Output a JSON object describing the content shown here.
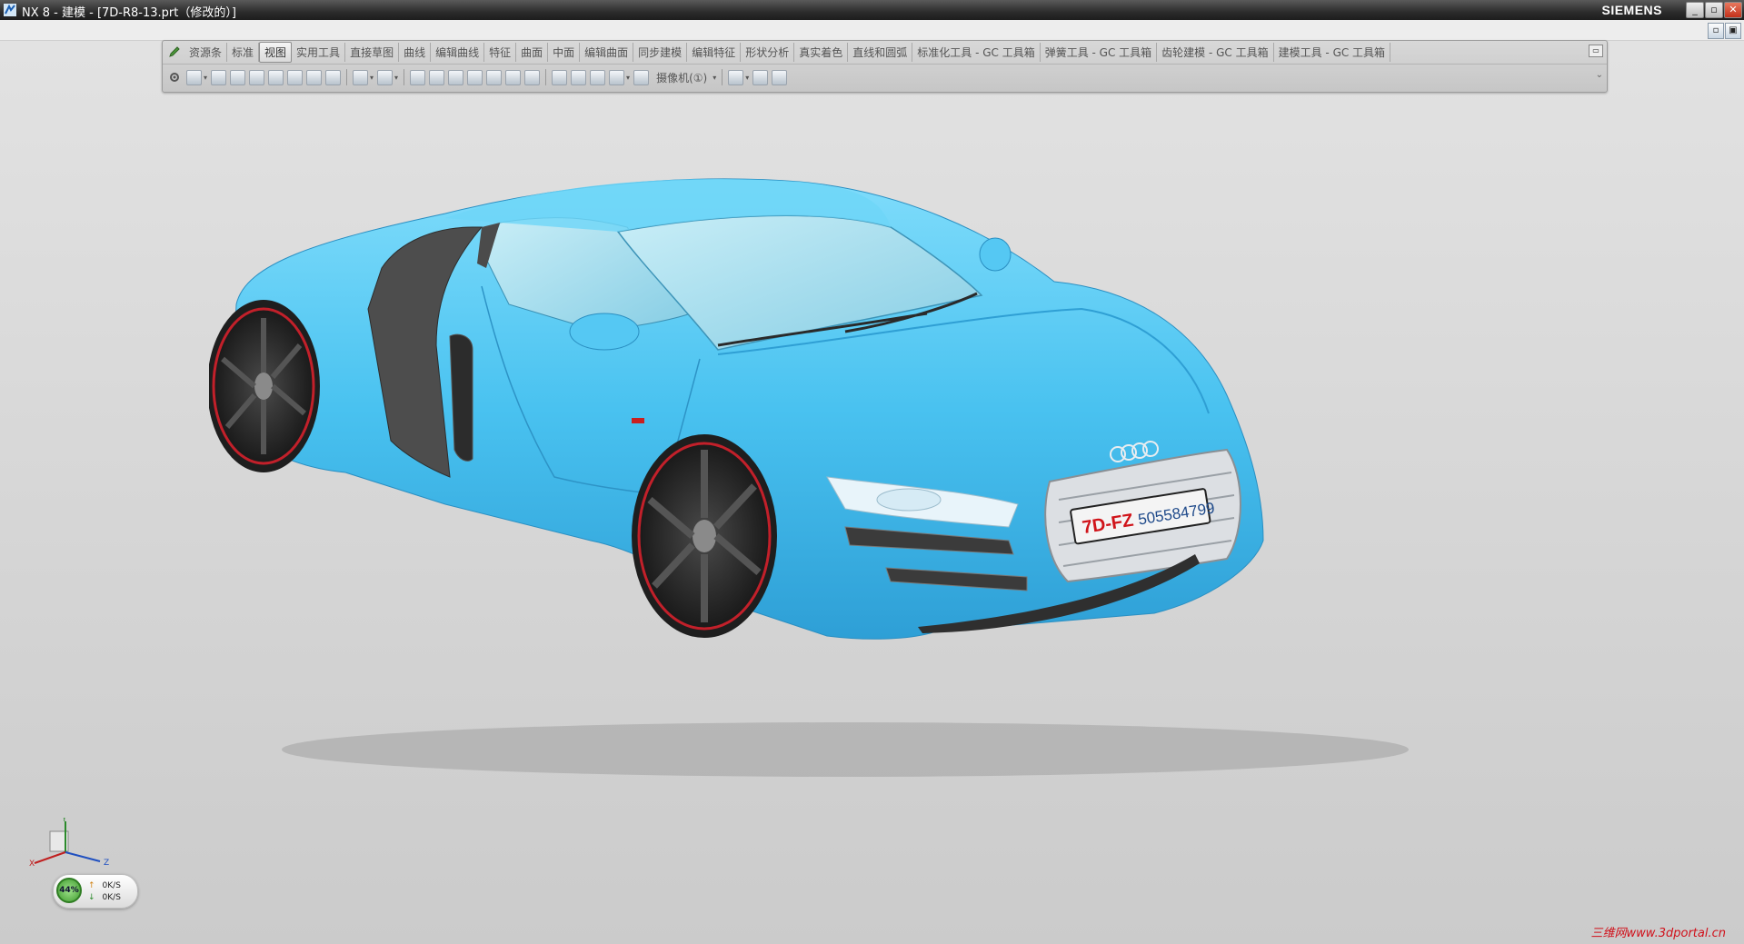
{
  "window": {
    "title": "NX 8 - 建模 - [7D-R8-13.prt（修改的）]",
    "brand": "SIEMENS",
    "buttons": {
      "minimize": "_",
      "maximize": "▫",
      "close": "✕"
    }
  },
  "ribbon": {
    "tabs": [
      {
        "label": "资源条"
      },
      {
        "label": "标准"
      },
      {
        "label": "视图",
        "active": true
      },
      {
        "label": "实用工具"
      },
      {
        "label": "直接草图"
      },
      {
        "label": "曲线"
      },
      {
        "label": "编辑曲线"
      },
      {
        "label": "特征"
      },
      {
        "label": "曲面"
      },
      {
        "label": "中面"
      },
      {
        "label": "编辑曲面"
      },
      {
        "label": "同步建模"
      },
      {
        "label": "编辑特征"
      },
      {
        "label": "形状分析"
      },
      {
        "label": "真实着色"
      },
      {
        "label": "直线和圆弧"
      },
      {
        "label": "标准化工具 - GC 工具箱"
      },
      {
        "label": "弹簧工具 - GC 工具箱"
      },
      {
        "label": "齿轮建模 - GC 工具箱"
      },
      {
        "label": "建模工具 - GC 工具箱"
      }
    ],
    "camera_select": "摄像机(①)"
  },
  "viewport": {
    "model_color": "#4fc6f2",
    "plate_text_red": "7D-FZ",
    "plate_text_blue": "505584799",
    "triad_axes": {
      "x": "X",
      "y": "Y",
      "z": "Z"
    }
  },
  "perf": {
    "percent": "44%",
    "up_rate": "0K/S",
    "down_rate": "0K/S"
  },
  "watermark": "三维网www.3dportal.cn"
}
